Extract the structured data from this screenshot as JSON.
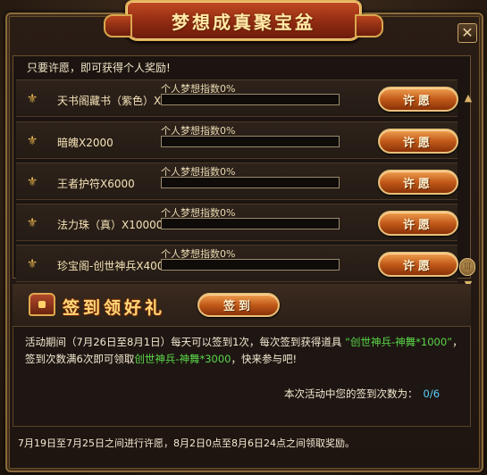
{
  "window": {
    "title": "梦想成真聚宝盆",
    "close_glyph": "✕"
  },
  "hint": "只要许愿，即可获得个人奖励!",
  "dream_label": "个人梦想指数0%",
  "wish_label": "许愿",
  "rewards": [
    {
      "name": "天书阁藏书（紫色）X20000",
      "progress": 0
    },
    {
      "name": "暗魄X2000",
      "progress": 0
    },
    {
      "name": "王者护符X6000",
      "progress": 0
    },
    {
      "name": "法力珠（真）X10000",
      "progress": 0
    },
    {
      "name": "珍宝阁-创世神兵X40000",
      "progress": 0
    }
  ],
  "signin": {
    "title": "签到领好礼",
    "button": "签到",
    "desc_part1": "活动期间（7月26日至8月1日）每天可以签到1次，每次签到获得道具",
    "desc_item1": "“创世神兵-神舞*1000”",
    "desc_part2": "，签到次数满6次即可领取",
    "desc_item2": "创世神兵-神舞*3000",
    "desc_part3": "，快来参与吧!",
    "count_label": "本次活动中您的签到次数为：",
    "count_value": "0/6"
  },
  "footer": "7月19日至7月25日之间进行许愿，8月2日0点至8月6日24点之间领取奖励。",
  "colors": {
    "accent_gold": "#e2b04c",
    "highlight_green": "#5ad84a",
    "count_blue": "#5ad0ff",
    "button_orange": "#c25a1a"
  },
  "icons": {
    "row_icon": "fleur-de-lis-icon",
    "close": "close-icon",
    "scroll_up": "scroll-up-arrow-icon",
    "scroll_thumb": "scroll-thumb-icon",
    "scroll_down": "scroll-down-arrow-icon",
    "chest": "treasure-chest-icon"
  }
}
